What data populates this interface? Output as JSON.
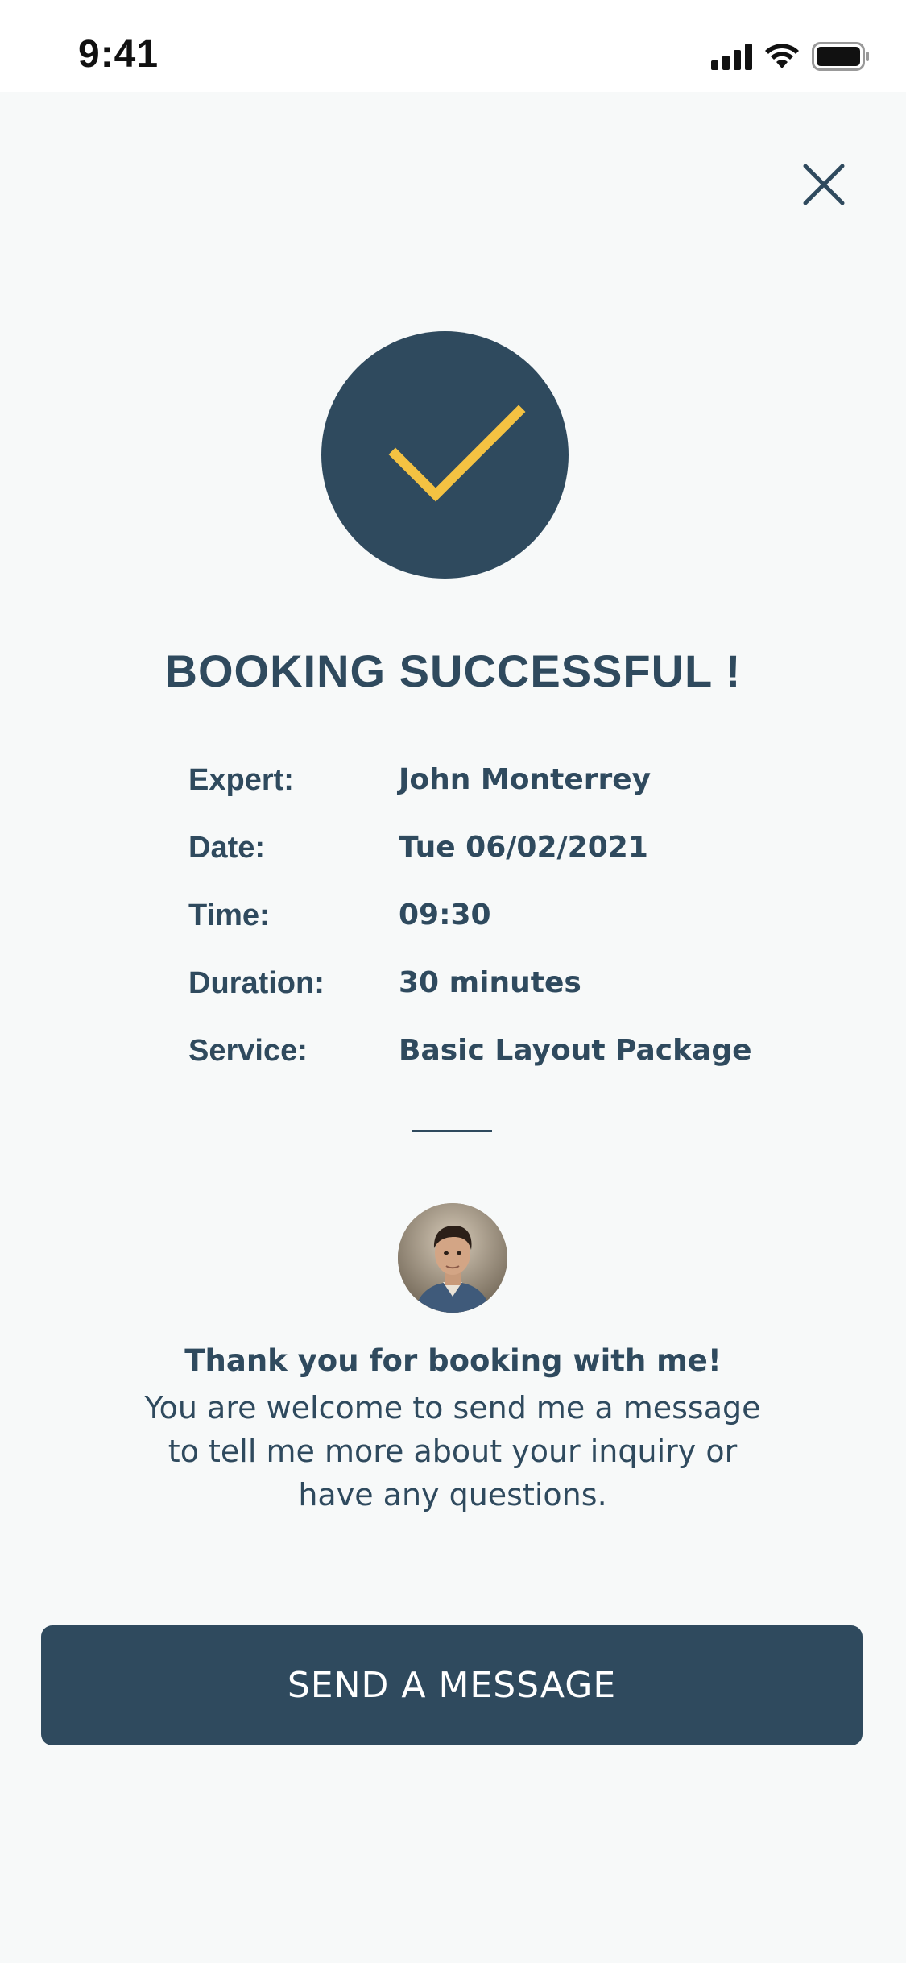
{
  "status_bar": {
    "time": "9:41",
    "icons": [
      "signal-icon",
      "wifi-icon",
      "battery-icon"
    ]
  },
  "header": {
    "close_icon": "close-icon"
  },
  "success": {
    "icon": "checkmark-icon",
    "title": "BOOKING SUCCESSFUL !"
  },
  "details": [
    {
      "label": "Expert:",
      "value": "John Monterrey"
    },
    {
      "label": "Date:",
      "value": "Tue 06/02/2021"
    },
    {
      "label": "Time:",
      "value": "09:30"
    },
    {
      "label": "Duration:",
      "value": "30 minutes"
    },
    {
      "label": "Service:",
      "value": "Basic Layout Package"
    }
  ],
  "message": {
    "title": "Thank you for booking with me!",
    "body": "You are welcome to send me a message to tell me more about your inquiry or have any questions."
  },
  "button": {
    "label": "SEND A MESSAGE"
  },
  "colors": {
    "primary": "#2f4a5e",
    "accent": "#f4c242",
    "background": "#f7f9f9"
  }
}
